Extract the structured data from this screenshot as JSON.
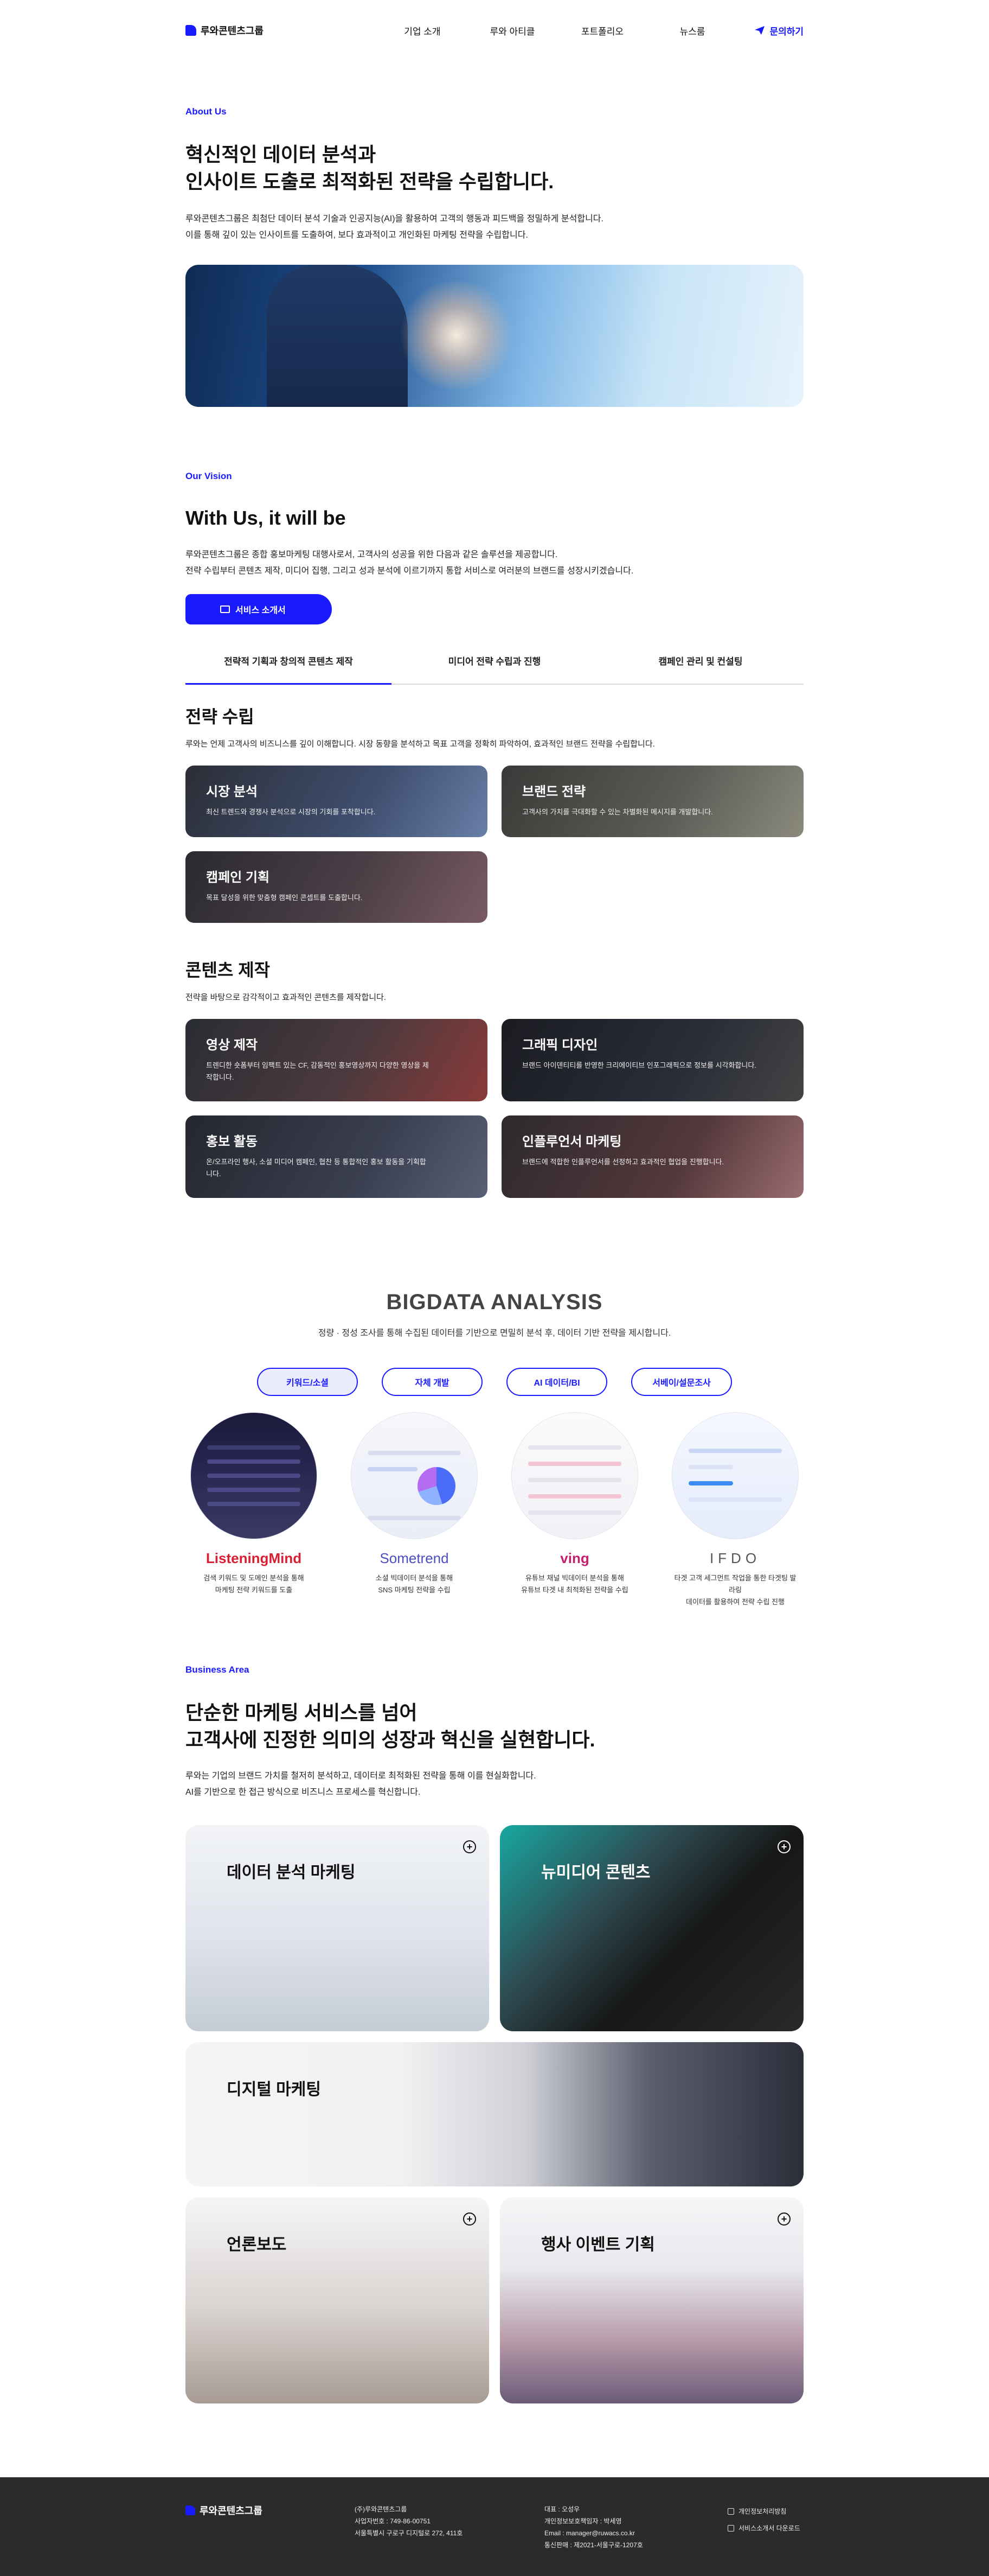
{
  "header": {
    "logo_text": "루와콘텐츠그룹",
    "nav": [
      "기업 소개",
      "루와 아티클",
      "포트폴리오",
      "뉴스룸"
    ],
    "cta": "문의하기"
  },
  "about": {
    "label": "About Us",
    "title_line1": "혁신적인 데이터 분석과",
    "title_line2": "인사이트 도출로 최적화된 전략을 수립합니다.",
    "desc_line1": "루와콘텐츠그룹은 최첨단 데이터 분석 기술과 인공지능(AI)을 활용하여 고객의 행동과 피드백을 정밀하게 분석합니다.",
    "desc_line2": "이를 통해 깊이 있는 인사이트를 도출하여, 보다 효과적이고 개인화된 마케팅 전략을 수립합니다."
  },
  "vision": {
    "label": "Our Vision",
    "title": "With Us, it will be",
    "desc_line1": "루와콘텐츠그룹은 종합 홍보마케팅 대행사로서, 고객사의 성공을 위한 다음과 같은 솔루션을 제공합니다.",
    "desc_line2": "전략 수립부터 콘텐츠 제작, 미디어 집행, 그리고 성과 분석에 이르기까지 통합 서비스로 여러분의 브랜드를 성장시키겠습니다.",
    "button": "서비스 소개서",
    "tabs": [
      "전략적 기획과 창의적 콘텐츠 제작",
      "미디어 전략 수립과 진행",
      "캠페인 관리 및 컨설팅"
    ]
  },
  "strategy": {
    "title": "전략 수립",
    "desc": "루와는 언제 고객사의 비즈니스를 깊이 이해합니다. 시장 동향을 분석하고 목표 고객을 정확히 파악하여, 효과적인 브랜드 전략을 수립합니다.",
    "cards": [
      {
        "title": "시장 분석",
        "desc": "최신 트렌드와 경쟁사 분석으로 시장의 기회를 포착합니다."
      },
      {
        "title": "브랜드 전략",
        "desc": "고객사의 가치를 극대화할 수 있는 차별화된 메시지를 개발합니다."
      },
      {
        "title": "캠페인 기획",
        "desc": "목표 달성을 위한 맞춤형 캠페인 콘셉트를 도출합니다."
      }
    ]
  },
  "content": {
    "title": "콘텐츠 제작",
    "desc": "전략을 바탕으로 감각적이고 효과적인 콘텐츠를 제작합니다.",
    "cards": [
      {
        "title": "영상 제작",
        "desc_line1": "트렌디한 숏폼부터 임팩트 있는 CF, 감동적인 홍보영상까지 다양한 영상을 제",
        "desc_line2": "작합니다."
      },
      {
        "title": "그래픽 디자인",
        "desc_line1": "브랜드 아이덴티티를 반영한 크리에이티브 인포그래픽으로 정보를 시각화합니다.",
        "desc_line2": ""
      },
      {
        "title": "홍보 활동",
        "desc_line1": "온/오프라인 행사, 소셜 미디어 캠페인, 협찬 등 통합적인 홍보 활동을 기획합",
        "desc_line2": "니다."
      },
      {
        "title": "인플루언서 마케팅",
        "desc_line1": "브랜드에 적합한 인플루언서를 선정하고 효과적인 협업을 진행합니다.",
        "desc_line2": ""
      }
    ]
  },
  "bigdata": {
    "title": "BIGDATA ANALYSIS",
    "desc": "정량 · 정성 조사를 통해 수집된 데이터를 기반으로 면밀히 분석 후, 데이터 기반 전략을 제시합니다.",
    "pills": [
      "키워드/소셜",
      "자체 개발",
      "AI 데이터/BI",
      "서베이/설문조사"
    ],
    "tools": [
      {
        "name": "ListeningMind",
        "desc_line1": "검색 키워드 및 도메인 분석을 통해",
        "desc_line2": "마케팅 전략 키워드를 도출"
      },
      {
        "name": "Sometrend",
        "desc_line1": "소셜 빅데이터 분석을 통해",
        "desc_line2": "SNS 마케팅 전략을 수립"
      },
      {
        "name": "ving",
        "desc_line1": "유튜브 채널 빅데이터 분석을 통해",
        "desc_line2": "유튜브 타겟 내 최적화된 전략을 수립"
      },
      {
        "name": "IFDO",
        "desc_line1": "타겟 고객 세그먼트 작업을 통한 타겟팅 발라링",
        "desc_line2": "데이터를 활용하여 전략 수립 진행"
      }
    ]
  },
  "business": {
    "label": "Business Area",
    "title_line1": "단순한 마케팅 서비스를 넘어",
    "title_line2": "고객사에 진정한 의미의 성장과 혁신을 실현합니다.",
    "desc_line1": "루와는 기업의 브랜드 가치를 철저히 분석하고, 데이터로 최적화된 전략을 통해 이를 현실화합니다.",
    "desc_line2": "AI를 기반으로 한 접근 방식으로 비즈니스 프로세스를 혁신합니다.",
    "areas": [
      "데이터 분석 마케팅",
      "뉴미디어 콘텐츠",
      "디지털 마케팅",
      "언론보도",
      "행사 이벤트 기획"
    ],
    "plus_symbol": "+"
  },
  "footer": {
    "logo_text": "루와콘텐츠그룹",
    "company": "(주)루와콘텐츠그룹",
    "biz_no": "사업자번호 : 749-86-00751",
    "address": "서울특별시 구로구 디지털로 272, 411호",
    "ceo": "대표 : 오성우",
    "privacy_officer": "개인정보보호책임자 : 박세영",
    "email": "Email : manager@ruwacs.co.kr",
    "telecom": "통신판매 : 제2021-서울구로-1207호",
    "links": [
      "개인정보처리방침",
      "서비스소개서 다운로드"
    ]
  },
  "colors": {
    "accent": "#1a1aff",
    "footer_bg": "#2b2b2d"
  }
}
